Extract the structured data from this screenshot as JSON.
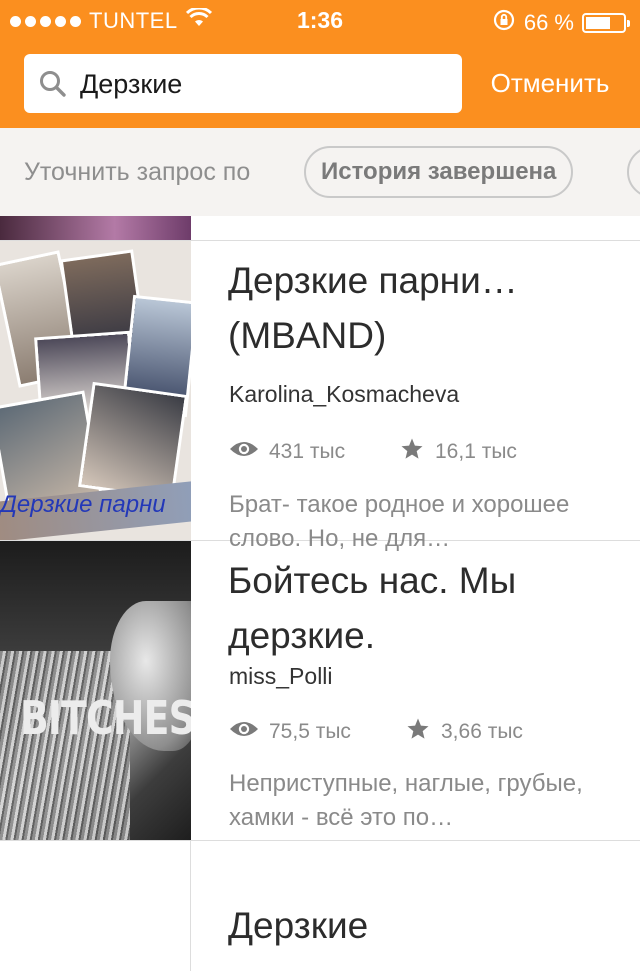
{
  "status_bar": {
    "carrier": "TUNTEL",
    "time": "1:36",
    "battery": "66 %",
    "battery_level": 0.66
  },
  "search": {
    "query": "Дерзкие",
    "cancel_label": "Отменить"
  },
  "filter": {
    "label": "Уточнить запрос по",
    "chip": "История завершена"
  },
  "stories": [
    {
      "title": "Дерзкие парни… (MBAND)",
      "author": "Karolina_Kosmacheva",
      "reads": "431 тыс",
      "votes": "16,1 тыс",
      "description": "Брат- такое родное и хорошее слово. Но, не для…",
      "cover_text": "Дерзкие парни"
    },
    {
      "title": "Бойтесь нас. Мы дерзкие.",
      "author": "miss_Polli",
      "reads": "75,5 тыс",
      "votes": "3,66 тыс",
      "description": "Неприступные, наглые, грубые, хамки - всё это по…",
      "cover_text": "BITCHES"
    },
    {
      "title": "Дерзкие"
    }
  ],
  "colors": {
    "accent": "#fb8f1f",
    "filter_bg": "#f5f3f1",
    "meta_text": "#8a8a8a"
  }
}
